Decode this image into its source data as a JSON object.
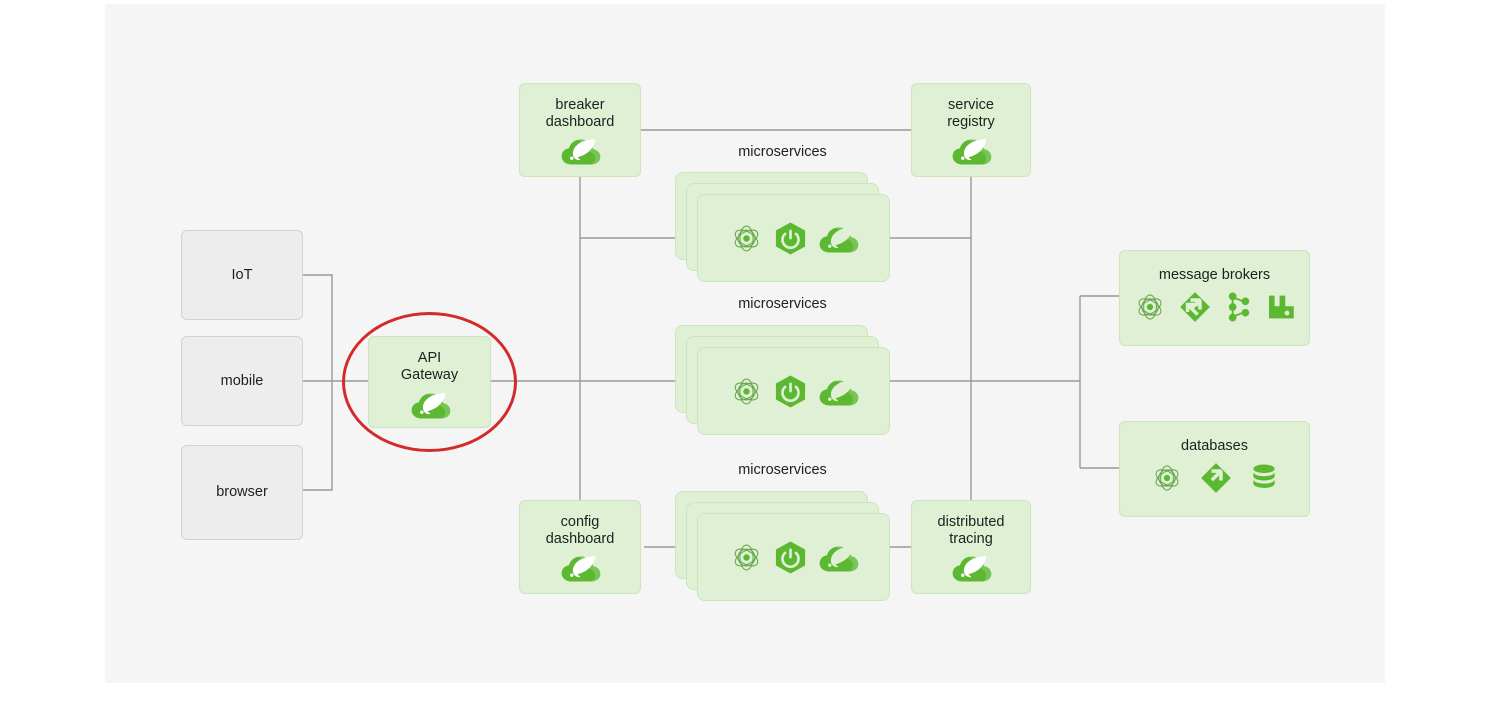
{
  "diagram": {
    "title": "microservices architecture diagram",
    "background_color": "#f5f5f5",
    "page_color": "#ffffff",
    "edge_color": "#9a9a9a",
    "highlight_color": "#d32b2b",
    "green_fill": "#dff0d5",
    "green_border": "#cbe5bd",
    "green_icon": "#5cb731",
    "grey_fill": "#ededed",
    "grey_border": "#d2d2d2"
  },
  "clients": [
    {
      "label": "IoT"
    },
    {
      "label": "mobile"
    },
    {
      "label": "browser"
    }
  ],
  "gateway": {
    "label": "API\nGateway",
    "icons": [
      "spring-cloud-icon"
    ],
    "highlighted": true
  },
  "platform_nodes": [
    {
      "id": "breaker-dashboard",
      "label": "breaker\ndashboard",
      "icons": [
        "spring-cloud-icon"
      ]
    },
    {
      "id": "service-registry",
      "label": "service\nregistry",
      "icons": [
        "spring-cloud-icon"
      ]
    },
    {
      "id": "config-dashboard",
      "label": "config\ndashboard",
      "icons": [
        "spring-cloud-icon"
      ]
    },
    {
      "id": "distributed-tracing",
      "label": "distributed\ntracing",
      "icons": [
        "spring-cloud-icon"
      ]
    }
  ],
  "microservice_stacks": [
    {
      "id": "microservices-top",
      "caption": "microservices",
      "layers": 3,
      "icons": [
        "atom-icon",
        "spring-boot-icon",
        "spring-cloud-icon"
      ]
    },
    {
      "id": "microservices-middle",
      "caption": "microservices",
      "layers": 3,
      "icons": [
        "atom-icon",
        "spring-boot-icon",
        "spring-cloud-icon"
      ]
    },
    {
      "id": "microservices-bottom",
      "caption": "microservices",
      "layers": 3,
      "icons": [
        "atom-icon",
        "spring-boot-icon",
        "spring-cloud-icon"
      ]
    }
  ],
  "backends": [
    {
      "id": "message-brokers",
      "label": "message brokers",
      "icons": [
        "atom-icon",
        "spring-integration-icon",
        "kafka-icon",
        "rabbitmq-icon"
      ]
    },
    {
      "id": "databases",
      "label": "databases",
      "icons": [
        "atom-icon",
        "spring-integration-icon",
        "database-icon"
      ]
    }
  ]
}
